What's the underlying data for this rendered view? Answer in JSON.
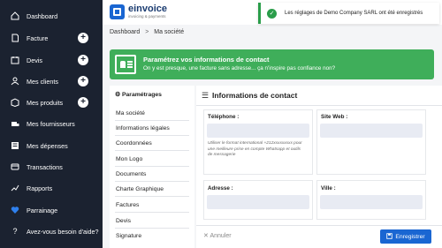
{
  "sidebar": {
    "items": [
      {
        "label": "Dashboard",
        "icon": "home-icon",
        "has_add": false
      },
      {
        "label": "Facture",
        "icon": "invoice-icon",
        "has_add": true
      },
      {
        "label": "Devis",
        "icon": "quote-icon",
        "has_add": true
      },
      {
        "label": "Mes clients",
        "icon": "users-icon",
        "has_add": true
      },
      {
        "label": "Mes produits",
        "icon": "products-icon",
        "has_add": true
      },
      {
        "label": "Mes fournisseurs",
        "icon": "suppliers-icon",
        "has_add": false
      },
      {
        "label": "Mes dépenses",
        "icon": "expenses-icon",
        "has_add": false
      },
      {
        "label": "Transactions",
        "icon": "transactions-icon",
        "has_add": false
      },
      {
        "label": "Rapports",
        "icon": "chart-icon",
        "has_add": false
      },
      {
        "label": "Parrainage",
        "icon": "heart-icon",
        "has_add": false
      },
      {
        "label": "Avez-vous besoin d'aide?",
        "icon": "help-icon",
        "has_add": false
      }
    ],
    "add_symbol": "+"
  },
  "header": {
    "logo_name": "einvoice",
    "logo_tagline": "invoicing & payments"
  },
  "toast": {
    "message": "Les réglages de Demo Company SARL ont été enregistrés",
    "check": "✓"
  },
  "breadcrumb": {
    "root": "Dashboard",
    "separator": ">",
    "current": "Ma société"
  },
  "banner": {
    "title": "Paramétrez vos informations de contact",
    "subtitle": "On y est presque, une facture sans adresse... ça n'inspire pas confiance non?"
  },
  "settings": {
    "title": "Paramétrages",
    "items": [
      "Ma société",
      "Informations légales",
      "Coordonnées",
      "Mon Logo",
      "Documents",
      "Charte Graphique",
      "Factures",
      "Devis",
      "Signature"
    ]
  },
  "contact": {
    "title": "Informations de contact",
    "phone_label": "Téléphone :",
    "phone_value": "",
    "phone_help": "Utiliser le format international +212xxxxxxxxx pour une meilleure prise en compte Whatsapp et outils de messagerie",
    "website_label": "Site Web :",
    "website_value": "",
    "address_label": "Adresse :",
    "address_value": "",
    "city_label": "Ville :",
    "city_value": ""
  },
  "footer": {
    "cancel_label": "Annuler",
    "save_label": "Enregistrer"
  },
  "colors": {
    "sidebar_bg": "#1b2230",
    "accent": "#1a66d2",
    "success": "#3fae5a",
    "heart": "#2f80ed"
  }
}
